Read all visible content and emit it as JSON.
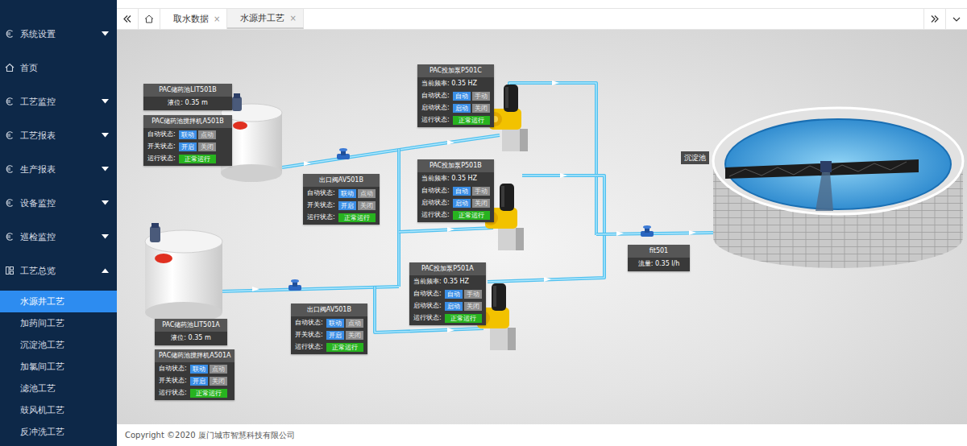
{
  "sidebar": {
    "items": [
      {
        "label": "系统设置",
        "has_children": true,
        "expanded": false
      },
      {
        "label": "首页",
        "has_children": false,
        "expanded": false
      },
      {
        "label": "工艺监控",
        "has_children": true,
        "expanded": false
      },
      {
        "label": "工艺报表",
        "has_children": true,
        "expanded": false
      },
      {
        "label": "生产报表",
        "has_children": true,
        "expanded": false
      },
      {
        "label": "设备监控",
        "has_children": true,
        "expanded": false
      },
      {
        "label": "巡检监控",
        "has_children": true,
        "expanded": false
      },
      {
        "label": "工艺总览",
        "has_children": true,
        "expanded": true
      }
    ],
    "subitems": [
      {
        "label": "水源井工艺",
        "selected": true
      },
      {
        "label": "加药间工艺",
        "selected": false
      },
      {
        "label": "沉淀池工艺",
        "selected": false
      },
      {
        "label": "加氯间工艺",
        "selected": false
      },
      {
        "label": "滤池工艺",
        "selected": false
      },
      {
        "label": "鼓风机工艺",
        "selected": false
      },
      {
        "label": "反冲洗工艺",
        "selected": false
      }
    ]
  },
  "tabs": [
    {
      "label": "取水数据",
      "selected": false,
      "close": "×"
    },
    {
      "label": "水源井工艺",
      "selected": true,
      "close": "×"
    }
  ],
  "panels": [
    {
      "title": "PAC储药池LIT501B",
      "rows": [
        {
          "kind": "value",
          "text": "液位: 0.35 m"
        }
      ]
    },
    {
      "title": "PAC储药池搅拌机A501B",
      "rows": [
        {
          "kind": "toggle",
          "label": "自动状态:",
          "options": [
            {
              "text": "联动",
              "selected": true
            },
            {
              "text": "点动",
              "selected": false
            }
          ]
        },
        {
          "kind": "toggle",
          "label": "开关状态:",
          "options": [
            {
              "text": "开启",
              "selected": true
            },
            {
              "text": "关闭",
              "selected": false
            }
          ]
        },
        {
          "kind": "status",
          "label": "运行状态:",
          "status": "正常运行",
          "color": "#27b31f"
        }
      ]
    },
    {
      "title": "出口阀AV501B",
      "rows": [
        {
          "kind": "toggle",
          "label": "自动状态:",
          "options": [
            {
              "text": "联动",
              "selected": true
            },
            {
              "text": "点动",
              "selected": false
            }
          ]
        },
        {
          "kind": "toggle",
          "label": "开关状态:",
          "options": [
            {
              "text": "开启",
              "selected": true
            },
            {
              "text": "关闭",
              "selected": false
            }
          ]
        },
        {
          "kind": "status",
          "label": "运行状态:",
          "status": "正常运行",
          "color": "#27b31f"
        }
      ]
    },
    {
      "title": "PAC投加泵P501C",
      "rows": [
        {
          "kind": "value",
          "text": "当前频率: 0.35 HZ"
        },
        {
          "kind": "toggle",
          "label": "自动状态:",
          "options": [
            {
              "text": "自动",
              "selected": true
            },
            {
              "text": "手动",
              "selected": false
            }
          ]
        },
        {
          "kind": "toggle",
          "label": "启动状态:",
          "options": [
            {
              "text": "启动",
              "selected": true
            },
            {
              "text": "关闭",
              "selected": false
            }
          ]
        },
        {
          "kind": "status",
          "label": "运行状态:",
          "status": "正常运行",
          "color": "#27b31f"
        }
      ]
    },
    {
      "title": "PAC投加泵P501B",
      "rows": [
        {
          "kind": "value",
          "text": "当前频率: 0.35 HZ"
        },
        {
          "kind": "toggle",
          "label": "自动状态:",
          "options": [
            {
              "text": "自动",
              "selected": true
            },
            {
              "text": "手动",
              "selected": false
            }
          ]
        },
        {
          "kind": "toggle",
          "label": "启动状态:",
          "options": [
            {
              "text": "启动",
              "selected": true
            },
            {
              "text": "关闭",
              "selected": false
            }
          ]
        },
        {
          "kind": "status",
          "label": "运行状态:",
          "status": "正常运行",
          "color": "#27b31f"
        }
      ]
    },
    {
      "title": "PAC投加泵P501A",
      "rows": [
        {
          "kind": "value",
          "text": "当前频率: 0.35 HZ"
        },
        {
          "kind": "toggle",
          "label": "自动状态:",
          "options": [
            {
              "text": "自动",
              "selected": true
            },
            {
              "text": "手动",
              "selected": false
            }
          ]
        },
        {
          "kind": "toggle",
          "label": "启动状态:",
          "options": [
            {
              "text": "启动",
              "selected": true
            },
            {
              "text": "关闭",
              "selected": false
            }
          ]
        },
        {
          "kind": "status",
          "label": "运行状态:",
          "status": "正常运行",
          "color": "#27b31f"
        }
      ]
    },
    {
      "title": "出口阀AV501B",
      "rows": [
        {
          "kind": "toggle",
          "label": "自动状态:",
          "options": [
            {
              "text": "联动",
              "selected": true
            },
            {
              "text": "点动",
              "selected": false
            }
          ]
        },
        {
          "kind": "toggle",
          "label": "开关状态:",
          "options": [
            {
              "text": "开启",
              "selected": true
            },
            {
              "text": "关闭",
              "selected": false
            }
          ]
        },
        {
          "kind": "status",
          "label": "运行状态:",
          "status": "正常运行",
          "color": "#27b31f"
        }
      ]
    },
    {
      "title": "PAC储药池LIT501A",
      "rows": [
        {
          "kind": "value",
          "text": "液位: 0.35 m"
        }
      ]
    },
    {
      "title": "PAC储药池搅拌机A501A",
      "rows": [
        {
          "kind": "toggle",
          "label": "自动状态:",
          "options": [
            {
              "text": "联动",
              "selected": true
            },
            {
              "text": "点动",
              "selected": false
            }
          ]
        },
        {
          "kind": "toggle",
          "label": "开关状态:",
          "options": [
            {
              "text": "开启",
              "selected": true
            },
            {
              "text": "关闭",
              "selected": false
            }
          ]
        },
        {
          "kind": "status",
          "label": "运行状态:",
          "status": "正常运行",
          "color": "#27b31f"
        }
      ]
    },
    {
      "title": "fit501",
      "rows": [
        {
          "kind": "value",
          "text": "流量: 0.35 l/h"
        }
      ]
    }
  ],
  "basin": {
    "label": "沉淀池"
  },
  "footer": {
    "copyright": "Copyright ©2020 厦门城市智慧科技有限公司"
  }
}
